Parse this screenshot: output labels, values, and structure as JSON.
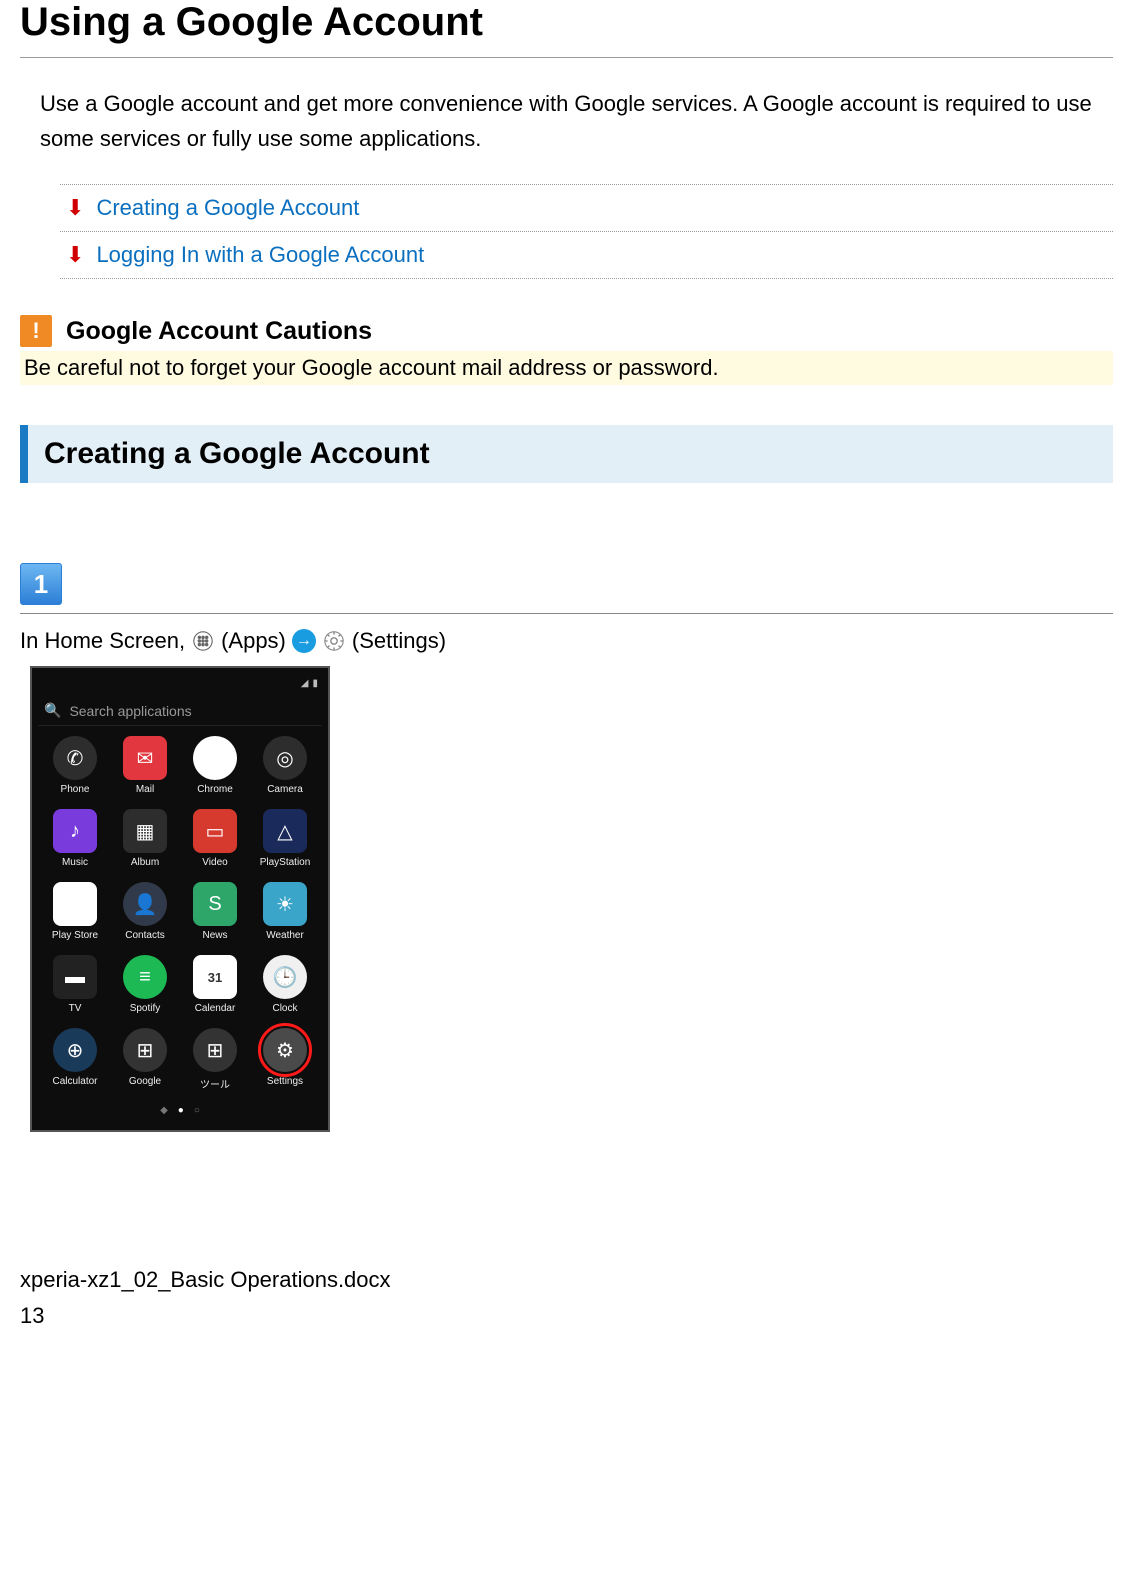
{
  "title": "Using a Google Account",
  "intro": "Use a Google account and get more convenience with Google services. A Google account is required to use some services or fully use some applications.",
  "toc": [
    {
      "label": "Creating a Google Account"
    },
    {
      "label": "Logging In with a Google Account"
    }
  ],
  "caution": {
    "heading": "Google Account Cautions",
    "body": "Be careful not to forget your Google account mail address or password."
  },
  "section_heading": "Creating a Google Account",
  "step": {
    "number": "1",
    "prefix": "In Home Screen,",
    "apps_label": "(Apps)",
    "settings_label": "(Settings)"
  },
  "phone": {
    "search_placeholder": "Search applications",
    "calendar_day": "31",
    "apps": [
      {
        "label": "Phone",
        "cls": "ic-phone",
        "glyph": "✆"
      },
      {
        "label": "Mail",
        "cls": "ic-mail",
        "glyph": "✉"
      },
      {
        "label": "Chrome",
        "cls": "ic-chrome",
        "glyph": "◉"
      },
      {
        "label": "Camera",
        "cls": "ic-camera",
        "glyph": "◎"
      },
      {
        "label": "Music",
        "cls": "ic-music",
        "glyph": "♪"
      },
      {
        "label": "Album",
        "cls": "ic-album",
        "glyph": "▦"
      },
      {
        "label": "Video",
        "cls": "ic-video",
        "glyph": "▭"
      },
      {
        "label": "PlayStation",
        "cls": "ic-ps",
        "glyph": "△"
      },
      {
        "label": "Play Store",
        "cls": "ic-play",
        "glyph": "▶"
      },
      {
        "label": "Contacts",
        "cls": "ic-contacts",
        "glyph": "👤"
      },
      {
        "label": "News",
        "cls": "ic-news",
        "glyph": "S"
      },
      {
        "label": "Weather",
        "cls": "ic-weather",
        "glyph": "☀"
      },
      {
        "label": "TV",
        "cls": "ic-tv",
        "glyph": "▬"
      },
      {
        "label": "Spotify",
        "cls": "ic-spotify",
        "glyph": "≡"
      },
      {
        "label": "Calendar",
        "cls": "ic-calendar",
        "glyph": "31"
      },
      {
        "label": "Clock",
        "cls": "ic-clock",
        "glyph": "🕒"
      },
      {
        "label": "Calculator",
        "cls": "ic-calc",
        "glyph": "⊕"
      },
      {
        "label": "Google",
        "cls": "ic-google",
        "glyph": "⊞"
      },
      {
        "label": "ツール",
        "cls": "ic-tools",
        "glyph": "⊞"
      },
      {
        "label": "Settings",
        "cls": "ic-settings",
        "glyph": "⚙",
        "highlight": true
      }
    ]
  },
  "footer": {
    "filename": "xperia-xz1_02_Basic Operations.docx",
    "page_number": "13"
  }
}
